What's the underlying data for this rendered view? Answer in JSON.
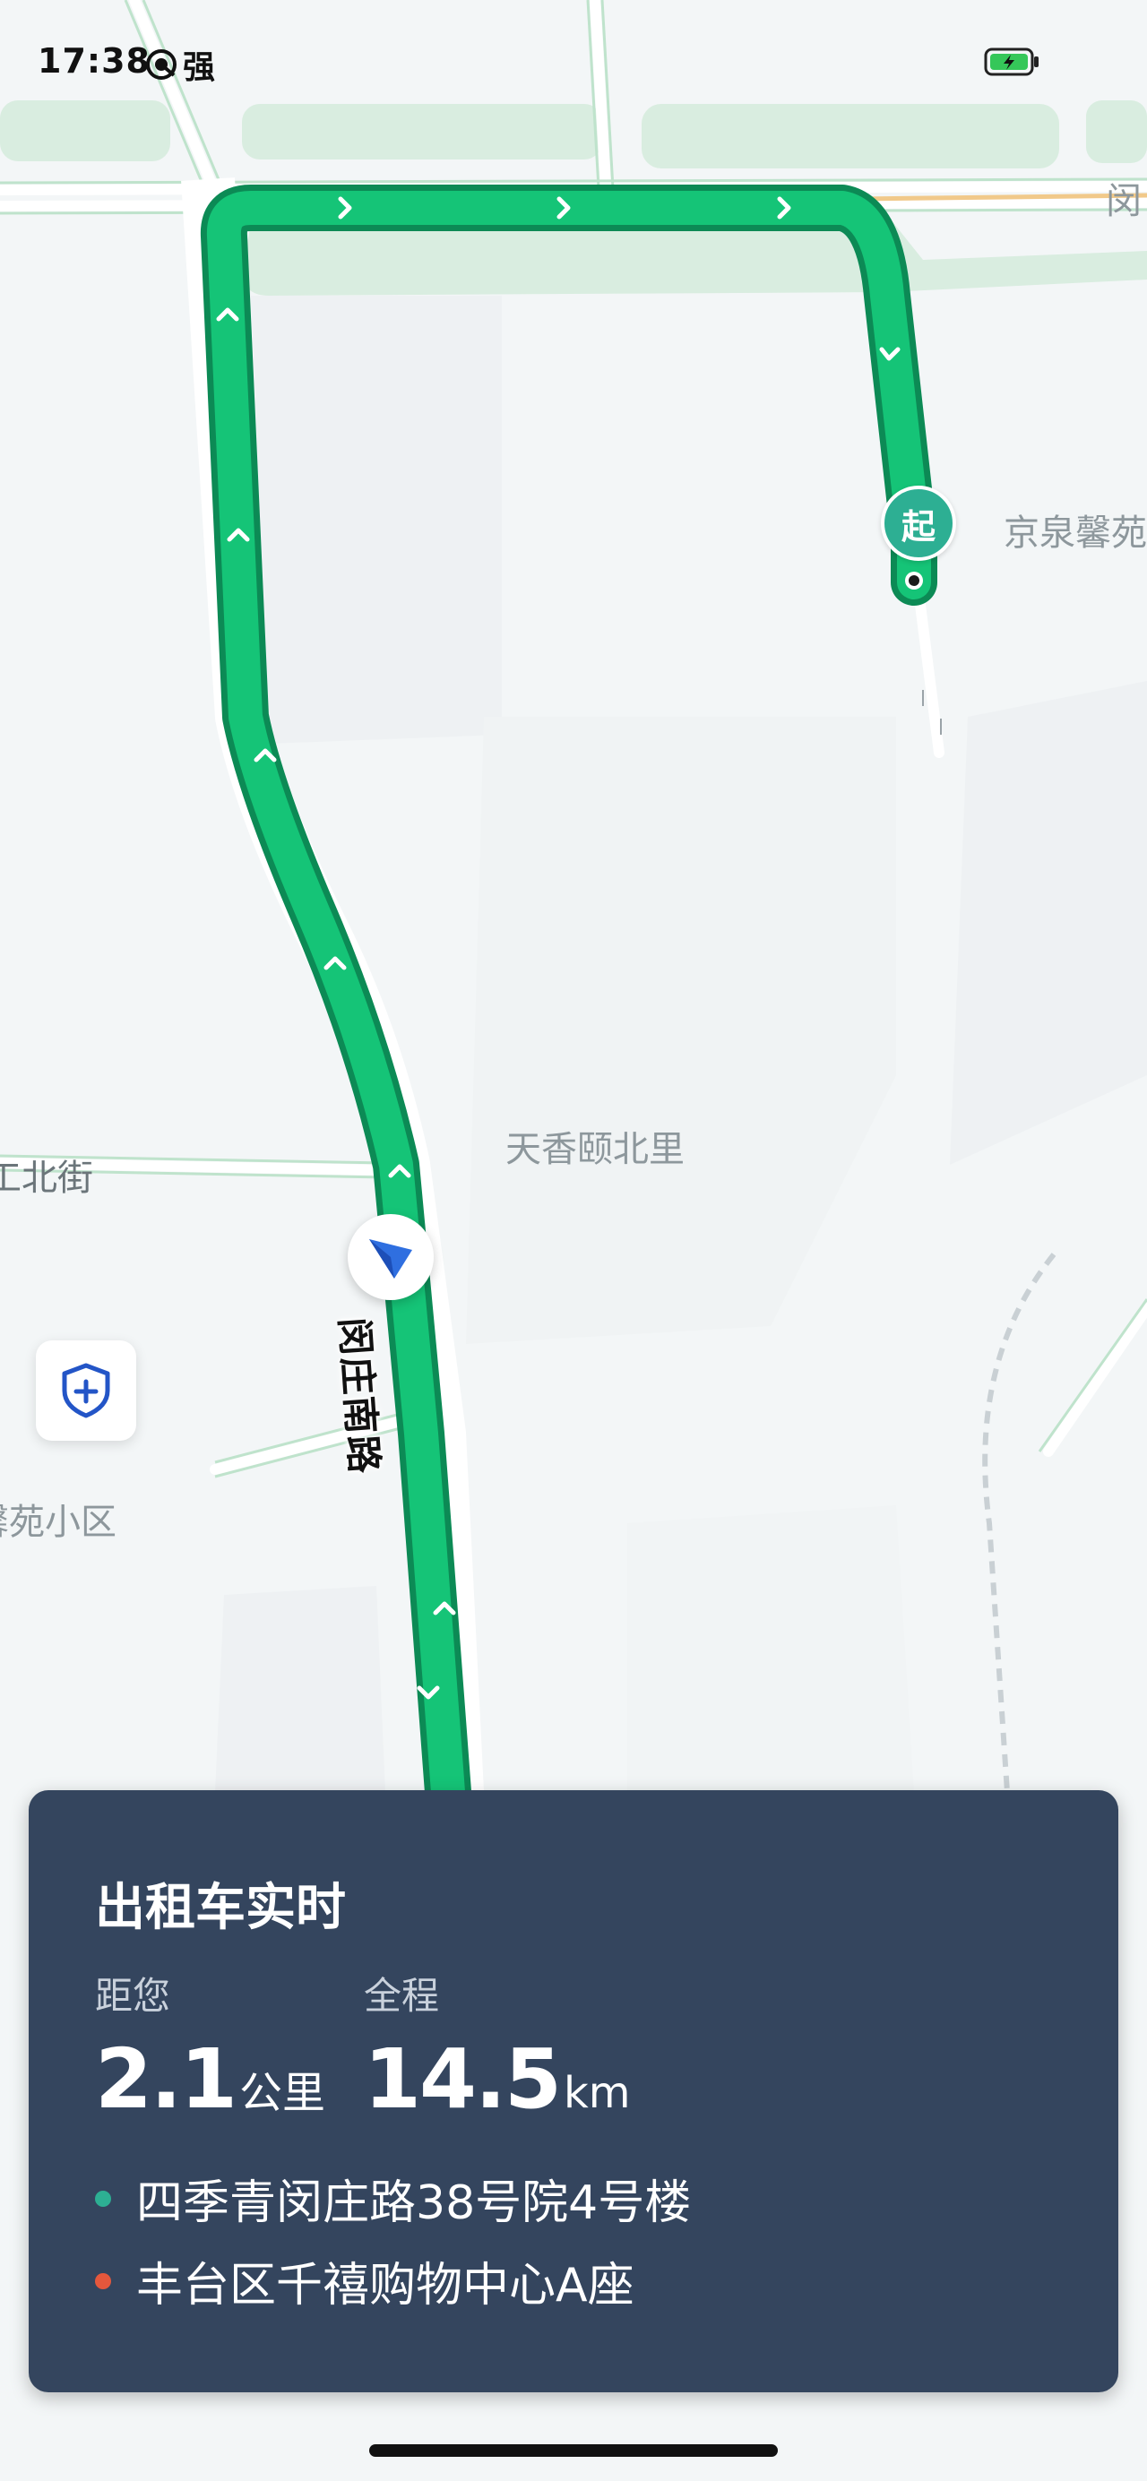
{
  "status_bar": {
    "time": "17:38",
    "signal_text": "强",
    "signal_icon": "hotspot-icon",
    "battery_icon": "battery-charging-icon"
  },
  "map": {
    "labels": {
      "top_right_fragment": "闵",
      "community_top_right": "京泉馨苑",
      "district_center": "天香颐北里",
      "street_left": "工北街",
      "community_left": "馨苑小区",
      "main_road": "闵庄南路"
    },
    "start_marker": "起",
    "colors": {
      "route": "#15c477",
      "route_border": "#0c8a55",
      "start_marker": "#2daf93",
      "navigation_arrow": "#2f6fe0"
    }
  },
  "safety_button": {
    "icon": "shield-plus-icon"
  },
  "card": {
    "title": "出租车实时",
    "distance_label": "距您",
    "distance_value": "2.1",
    "distance_unit": "公里",
    "total_label": "全程",
    "total_value": "14.5",
    "total_unit": "km",
    "origin": "四季青闵庄路38号院4号楼",
    "origin_color": "#2daf93",
    "destination": "丰台区千禧购物中心A座",
    "destination_color": "#e5573c",
    "background_color": "#34455e"
  }
}
